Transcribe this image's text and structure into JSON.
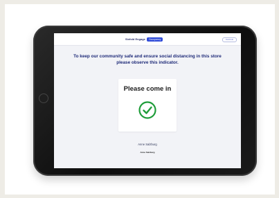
{
  "header": {
    "brand_name": "Sixfold Engage",
    "brand_badge": "Occupancy",
    "action_button": "Controls"
  },
  "main": {
    "message": "To keep our community safe and ensure social distancing in this store please observe this indicator.",
    "indicator": {
      "label": "Please come in",
      "icon": "check-circle-icon",
      "color": "#1f9d3a"
    }
  },
  "footer": {
    "store_name": "Anne Salzburg",
    "store_logo_text": "Anne Salzburg"
  }
}
